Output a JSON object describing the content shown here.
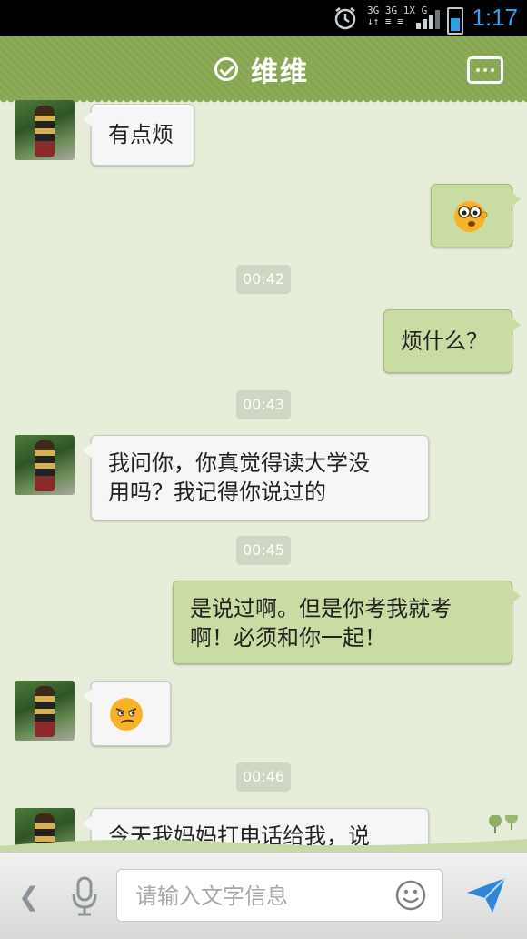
{
  "status": {
    "time": "1:17",
    "network_top": "3G 3G 1X G",
    "network_bottom": "↓↑ ≡ ≡"
  },
  "header": {
    "title": "维维"
  },
  "messages": [
    {
      "side": "left",
      "text": "有点烦"
    },
    {
      "side": "right",
      "emoji": "shocked-face"
    },
    {
      "type": "time",
      "text": "00:42"
    },
    {
      "side": "right",
      "text": "烦什么？"
    },
    {
      "type": "time",
      "text": "00:43"
    },
    {
      "side": "left",
      "lines": [
        "我问你，你真觉得读大学没",
        "用吗？我记得你说过的"
      ]
    },
    {
      "type": "time",
      "text": "00:45"
    },
    {
      "side": "right",
      "lines": [
        "是说过啊。但是你考我就考",
        "啊！必须和你一起！"
      ]
    },
    {
      "side": "left",
      "emoji": "smirk-face"
    },
    {
      "type": "time",
      "text": "00:46"
    },
    {
      "side": "left",
      "lines": [
        "今天我妈妈打电话给我，说"
      ]
    }
  ],
  "input": {
    "placeholder": "请输入文字信息",
    "value": ""
  },
  "colors": {
    "header": "#8aa855",
    "chat_bg": "#e6edd9",
    "bubble_right": "#c9dca3",
    "bubble_left": "#f6f6f6",
    "send": "#2e86d6"
  }
}
